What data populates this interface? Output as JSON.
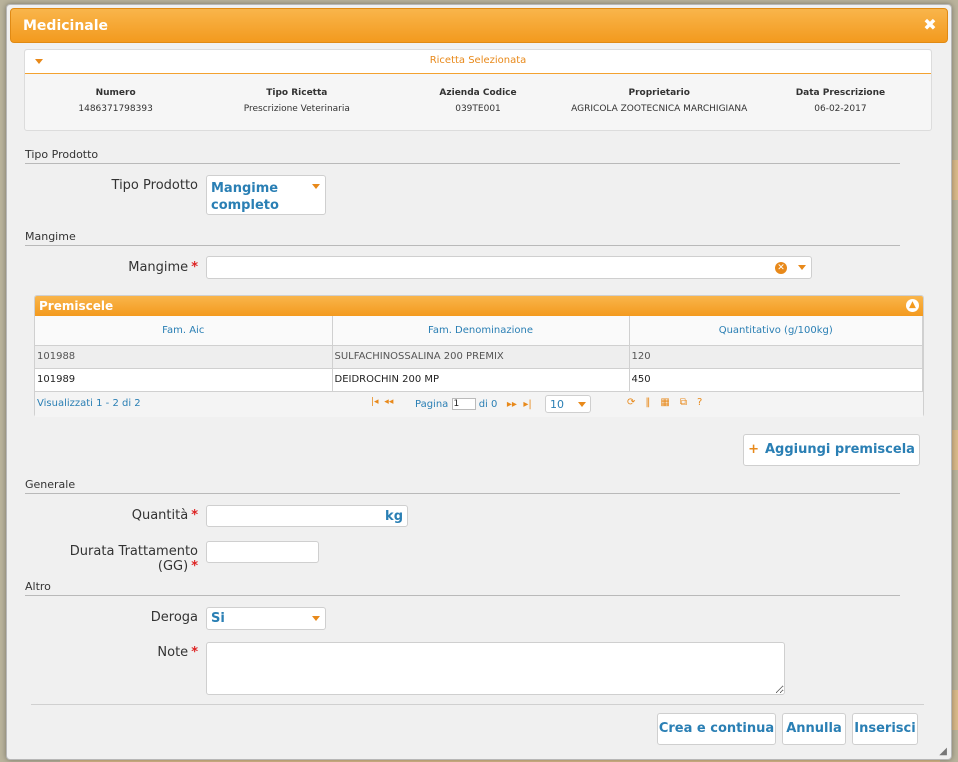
{
  "dialog": {
    "title": "Medicinale",
    "close_icon": "close-icon"
  },
  "ricetta": {
    "header": "Ricetta Selezionata",
    "columns": [
      {
        "label": "Numero",
        "value": "1486371798393"
      },
      {
        "label": "Tipo Ricetta",
        "value": "Prescrizione Veterinaria"
      },
      {
        "label": "Azienda Codice",
        "value": "039TE001"
      },
      {
        "label": "Proprietario",
        "value": "AGRICOLA ZOOTECNICA MARCHIGIANA"
      },
      {
        "label": "Data Prescrizione",
        "value": "06-02-2017"
      }
    ]
  },
  "sections": {
    "tipo_prodotto": "Tipo Prodotto",
    "mangime": "Mangime",
    "generale": "Generale",
    "altro": "Altro"
  },
  "fields": {
    "tipo_prodotto_label": "Tipo Prodotto",
    "tipo_prodotto_value_line1": "Mangime",
    "tipo_prodotto_value_line2": "completo",
    "mangime_label": "Mangime",
    "quantita_label": "Quantità",
    "quantita_unit": "kg",
    "durata_label": "Durata Trattamento (GG)",
    "deroga_label": "Deroga",
    "deroga_value": "Si",
    "note_label": "Note",
    "required_mark": "*"
  },
  "premiscele": {
    "title": "Premiscele",
    "columns": [
      "Fam. Aic",
      "Fam. Denominazione",
      "Quantitativo (g/100kg)"
    ],
    "rows": [
      [
        "101988",
        "SULFACHINOSSALINA 200 PREMIX",
        "120"
      ],
      [
        "101989",
        "DEIDROCHIN 200 MP",
        "450"
      ]
    ],
    "pager": {
      "info": "Visualizzati 1 - 2 di 2",
      "page_label": "Pagina",
      "page_value": "1",
      "of_label": "di 0",
      "rows_per_page": "10"
    }
  },
  "buttons": {
    "aggiungi": "Aggiungi premiscela",
    "aggiungi_icon": "+",
    "crea_continua": "Crea e continua",
    "annulla": "Annulla",
    "inserisci": "Inserisci"
  }
}
